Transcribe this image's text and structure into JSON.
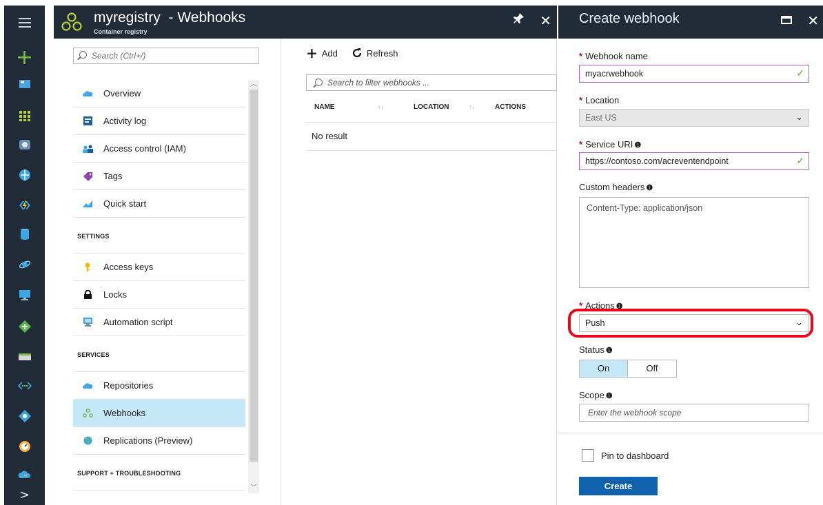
{
  "rail": {
    "plus": "+",
    "icons": [
      "dashboard-icon",
      "all-resources-icon",
      "resource-groups-icon",
      "app-services-icon",
      "function-apps-icon",
      "sql-databases-icon",
      "cosmos-db-icon",
      "virtual-machines-icon",
      "load-balancers-icon",
      "storage-accounts-icon",
      "virtual-networks-icon",
      "active-directory-icon",
      "monitor-icon",
      "advisor-icon"
    ],
    "more": ">"
  },
  "blade": {
    "title": "myregistry",
    "title_separator": "- Webhooks",
    "subtitle": "Container registry",
    "pin": "📌",
    "close": "✕"
  },
  "nav": {
    "search_placeholder": "Search (Ctrl+/)",
    "items": [
      {
        "label": "Overview",
        "icon": "overview-icon"
      },
      {
        "label": "Activity log",
        "icon": "activity-log-icon"
      },
      {
        "label": "Access control (IAM)",
        "icon": "access-control-icon"
      },
      {
        "label": "Tags",
        "icon": "tag-icon"
      },
      {
        "label": "Quick start",
        "icon": "quick-start-icon"
      }
    ],
    "settings_heading": "SETTINGS",
    "settings_items": [
      {
        "label": "Access keys",
        "icon": "key-icon"
      },
      {
        "label": "Locks",
        "icon": "lock-icon"
      },
      {
        "label": "Automation script",
        "icon": "automation-script-icon"
      }
    ],
    "services_heading": "SERVICES",
    "services_items": [
      {
        "label": "Repositories",
        "icon": "repositories-icon"
      },
      {
        "label": "Webhooks",
        "icon": "webhooks-icon",
        "active": true
      },
      {
        "label": "Replications (Preview)",
        "icon": "replications-icon"
      }
    ],
    "support_heading": "SUPPORT + TROUBLESHOOTING"
  },
  "list": {
    "add_label": "Add",
    "refresh_label": "Refresh",
    "filter_placeholder": "Search to filter webhooks ...",
    "columns": [
      "NAME",
      "LOCATION",
      "ACTIONS"
    ],
    "empty": "No result"
  },
  "panel": {
    "title": "Create webhook",
    "maximize": "maximize",
    "close": "✕",
    "webhook_name_label": "Webhook name",
    "webhook_name_value": "myacrwebhook",
    "location_label": "Location",
    "location_value": "East US",
    "service_uri_label": "Service URI",
    "service_uri_value": "https://contoso.com/acreventendpoint",
    "custom_headers_label": "Custom headers",
    "custom_headers_value": "Content-Type: application/json",
    "actions_label": "Actions",
    "actions_value": "Push",
    "status_label": "Status",
    "status_on": "On",
    "status_off": "Off",
    "scope_label": "Scope",
    "scope_placeholder": "Enter the webhook scope",
    "pin_label": "Pin to dashboard",
    "create_label": "Create",
    "required_mark": "*",
    "check": "✓",
    "caret": "⌄",
    "info": "❶"
  },
  "colors": {
    "chrome": "#212c38",
    "accent": "#0f62ab",
    "selected": "#c5e8f8",
    "highlight": "#e8091c",
    "valid_border": "#b35fcf",
    "check": "#5fa83c"
  }
}
